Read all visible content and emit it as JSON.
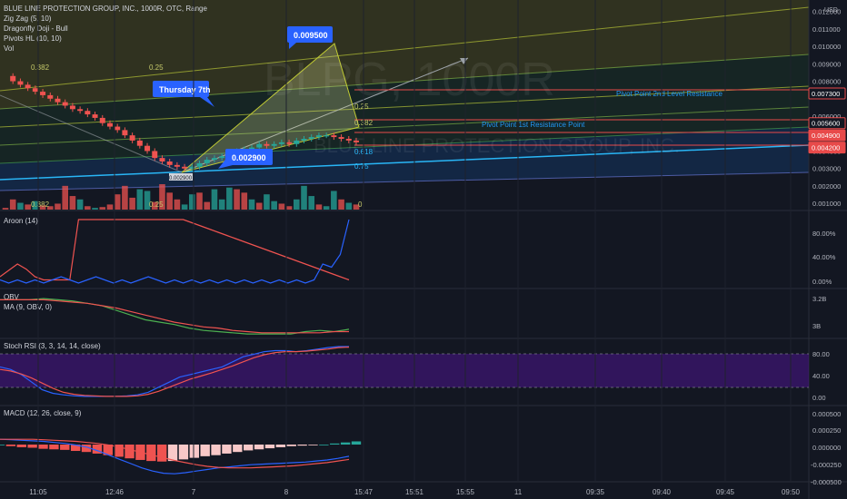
{
  "header": {
    "title": "BLUE LINE PROTECTION GROUP, INC., 1000R, OTC, Range",
    "overlays": [
      "Zig Zag (5, 10)",
      "Dragonfly Doji - Bull",
      "Pivots HL (10, 10)",
      "Vol"
    ]
  },
  "watermark": {
    "line1": "BLPG, 1000R",
    "line2": "BLUE LINE PROTECTION GROUP, INC."
  },
  "price_axis": {
    "currency": "USD",
    "ticks": [
      "0.012000",
      "0.011000",
      "0.010000",
      "0.009000",
      "0.008000",
      "0.006000",
      "0.005000",
      "0.004000",
      "0.003000",
      "0.002000",
      "0.001000"
    ],
    "tick_values": [
      0.012,
      0.011,
      0.01,
      0.009,
      0.008,
      0.006,
      0.005,
      0.004,
      0.003,
      0.002,
      0.001
    ],
    "tags": [
      {
        "text": "0.007300",
        "value": 0.0073,
        "color": "#e84a4a",
        "style": "outline"
      },
      {
        "text": "0.005600",
        "value": 0.0056,
        "color": "#e84a4a",
        "style": "outline"
      },
      {
        "text": "0.004900",
        "value": 0.0049,
        "color": "#e84a4a",
        "style": "filled"
      },
      {
        "text": "0.004200",
        "value": 0.0042,
        "color": "#e84a4a",
        "style": "filled"
      }
    ]
  },
  "annotations": {
    "callout_high": "0.009500",
    "callout_low": "0.002900",
    "callout_date": "Thursday 7th",
    "pivot_r2": "Pivot Point 2nd Level Resistance",
    "pivot_r1": "Pivot Point 1st Resistance Point",
    "fib_labels": [
      "0.382",
      "0.25",
      "0.25",
      "0.382",
      "0.618",
      "0.75",
      "0.25",
      "0.382",
      "0"
    ],
    "small_label": "0.002900"
  },
  "time_axis": [
    "11:05",
    "12:46",
    "7",
    "8",
    "15:47",
    "15:51",
    "15:55",
    "11",
    "09:35",
    "09:40",
    "09:45",
    "09:50"
  ],
  "panes": {
    "aroon": {
      "title": "Aroon (14)",
      "ticks": [
        "80.00%",
        "40.00%",
        "0.00%"
      ]
    },
    "obv": {
      "title": "OBV",
      "subtitle": "MA (9, OBV, 0)",
      "ticks": [
        "3.2B",
        "3B"
      ]
    },
    "stoch": {
      "title": "Stoch RSI (3, 3, 14, 14, close)",
      "ticks": [
        "80.00",
        "40.00",
        "0.00"
      ]
    },
    "macd": {
      "title": "MACD (12, 26, close, 9)",
      "ticks": [
        "0.000500",
        "0.000250",
        "0.000000",
        "-0.000250",
        "-0.000500"
      ]
    }
  },
  "colors": {
    "background": "#131722",
    "up": "#26a69a",
    "down": "#ef5350",
    "grid": "#1e222d",
    "text": "#b2b5be",
    "callout": "#2962ff",
    "pivot": "#2196f3",
    "stoch_band": "#4a148c"
  },
  "chart_data": [
    {
      "type": "candlestick",
      "title": "BLUE LINE PROTECTION GROUP, INC., 1000R, OTC, Range",
      "y_unit": "USD",
      "ylim": [
        0.0008,
        0.0125
      ],
      "close": [
        0.0083,
        0.008,
        0.0078,
        0.0076,
        0.0074,
        0.0072,
        0.007,
        0.0068,
        0.0066,
        0.0064,
        0.0063,
        0.0061,
        0.0059,
        0.0056,
        0.0054,
        0.0052,
        0.0049,
        0.0046,
        0.0043,
        0.004,
        0.0036,
        0.0034,
        0.0032,
        0.0031,
        0.003,
        0.0031,
        0.0033,
        0.0035,
        0.0036,
        0.0037,
        0.0039,
        0.004,
        0.0041,
        0.0042,
        0.0044,
        0.0043,
        0.0044,
        0.0045,
        0.0044,
        0.0046,
        0.0047,
        0.0048,
        0.0049,
        0.0049,
        0.0048,
        0.0047,
        0.0046,
        0.0045
      ],
      "volume": [
        10,
        60,
        40,
        30,
        50,
        25,
        20,
        35,
        140,
        80,
        60,
        20,
        10,
        15,
        30,
        90,
        140,
        70,
        120,
        110,
        45,
        150,
        100,
        60,
        30,
        90,
        100,
        45,
        120,
        60,
        130,
        120,
        100,
        60,
        40,
        90,
        50,
        35,
        20,
        60,
        140,
        80,
        30,
        20,
        110,
        60,
        40,
        30
      ],
      "volume_up": [
        false,
        false,
        true,
        false,
        true,
        false,
        false,
        false,
        false,
        false,
        true,
        false,
        true,
        false,
        false,
        false,
        false,
        false,
        true,
        true,
        false,
        false,
        false,
        false,
        true,
        true,
        false,
        false,
        true,
        true,
        true,
        false,
        false,
        true,
        false,
        true,
        true,
        false,
        false,
        true,
        true,
        true,
        false,
        true,
        true,
        false,
        true,
        false
      ]
    },
    {
      "type": "line",
      "title": "Aroon (14)",
      "ylim": [
        0,
        100
      ],
      "series": [
        {
          "values": [
            10,
            20,
            30,
            22,
            10,
            5,
            5,
            5,
            5,
            100,
            100,
            100,
            100,
            100,
            100,
            100,
            100,
            100,
            100,
            100,
            100,
            100,
            95,
            90,
            85,
            80,
            75,
            70,
            65,
            60,
            55,
            50,
            45,
            40,
            35,
            30,
            25,
            20,
            15,
            10,
            5
          ]
        },
        {
          "values": [
            5,
            0,
            5,
            0,
            5,
            0,
            5,
            10,
            5,
            0,
            5,
            10,
            5,
            0,
            5,
            0,
            5,
            10,
            5,
            0,
            5,
            0,
            5,
            0,
            5,
            0,
            5,
            0,
            5,
            0,
            5,
            0,
            5,
            0,
            5,
            0,
            5,
            30,
            25,
            45,
            100
          ]
        }
      ]
    },
    {
      "type": "line",
      "title": "OBV",
      "ylim": [
        2.95,
        3.35
      ],
      "series": [
        {
          "values": [
            3.27,
            3.27,
            3.27,
            3.28,
            3.27,
            3.26,
            3.24,
            3.22,
            3.18,
            3.14,
            3.1,
            3.08,
            3.06,
            3.03,
            3.01,
            3.0,
            2.99,
            2.98,
            2.98,
            2.98,
            2.98,
            3.0,
            3.01,
            3.0,
            3.02
          ]
        },
        {
          "values": [
            3.27,
            3.27,
            3.27,
            3.27,
            3.26,
            3.25,
            3.24,
            3.22,
            3.2,
            3.17,
            3.14,
            3.11,
            3.08,
            3.06,
            3.04,
            3.03,
            3.01,
            3.0,
            2.99,
            2.99,
            2.99,
            2.99,
            2.99,
            3.0,
            3.0
          ]
        }
      ]
    },
    {
      "type": "line",
      "title": "Stoch RSI (3, 3, 14, 14, close)",
      "ylim": [
        0,
        100
      ],
      "series": [
        {
          "values": [
            60,
            55,
            45,
            30,
            15,
            8,
            5,
            3,
            2,
            2,
            2,
            2,
            3,
            5,
            10,
            20,
            30,
            40,
            45,
            50,
            55,
            60,
            70,
            80,
            85,
            90,
            92,
            92,
            90,
            92,
            95,
            98,
            100,
            100
          ]
        },
        {
          "values": [
            55,
            52,
            46,
            38,
            28,
            18,
            10,
            6,
            4,
            3,
            2,
            2,
            2,
            3,
            6,
            12,
            20,
            28,
            36,
            42,
            48,
            55,
            62,
            70,
            78,
            84,
            88,
            90,
            90,
            91,
            93,
            95,
            98,
            99
          ]
        }
      ]
    },
    {
      "type": "bar",
      "title": "MACD (12, 26, close, 9)",
      "ylim": [
        -0.00065,
        0.00065
      ],
      "histogram": [
        0,
        -3e-05,
        -5e-05,
        -6e-05,
        -8e-05,
        -9e-05,
        -0.0001,
        -0.00012,
        -0.00014,
        -0.00017,
        -0.0002,
        -0.00023,
        -0.00026,
        -0.00029,
        -0.00031,
        -0.00032,
        -0.00031,
        -0.00028,
        -0.00025,
        -0.00022,
        -0.0002,
        -0.00017,
        -0.00014,
        -0.00011,
        -9e-05,
        -7e-05,
        -5e-05,
        -3e-05,
        -2e-05,
        -1e-05,
        0,
        2e-05,
        4e-05,
        6e-05
      ],
      "series": [
        {
          "values": [
            0.0001,
            9e-05,
            8e-05,
            7e-05,
            6e-05,
            4e-05,
            2e-05,
            -1e-05,
            -5e-05,
            -0.00012,
            -0.0002,
            -0.00028,
            -0.00036,
            -0.00044,
            -0.0005,
            -0.00054,
            -0.00055,
            -0.00053,
            -0.0005,
            -0.00047,
            -0.00044,
            -0.00042,
            -0.0004,
            -0.00038,
            -0.00037,
            -0.00036,
            -0.00035,
            -0.00034,
            -0.00033,
            -0.00031,
            -0.00029,
            -0.00026,
            -0.00022
          ]
        },
        {
          "values": [
            0.0001,
            0.0001,
            0.0001,
            0.0001,
            9e-05,
            8e-05,
            7e-05,
            6e-05,
            4e-05,
            2e-05,
            -1e-05,
            -5e-05,
            -0.0001,
            -0.00015,
            -0.0002,
            -0.00025,
            -0.0003,
            -0.00034,
            -0.00038,
            -0.00041,
            -0.00043,
            -0.00044,
            -0.00044,
            -0.00044,
            -0.00043,
            -0.00042,
            -0.00041,
            -0.0004,
            -0.00038,
            -0.00036,
            -0.00034,
            -0.00031,
            -0.00028
          ]
        }
      ]
    }
  ]
}
